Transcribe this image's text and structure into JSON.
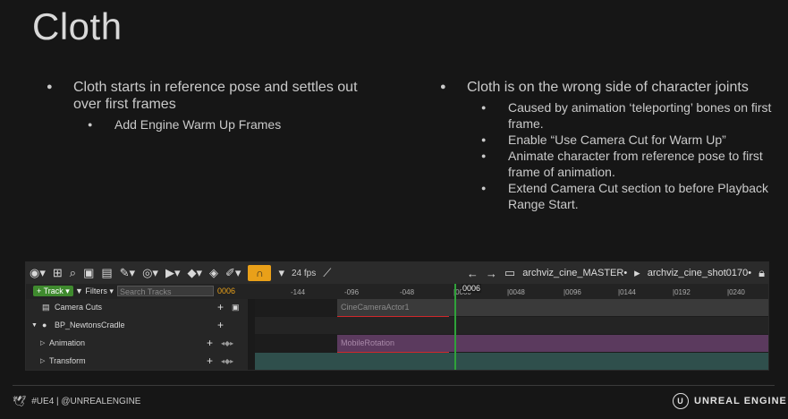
{
  "slide": {
    "title": "Cloth",
    "left_bullets": [
      {
        "text": "Cloth starts in reference pose and settles out over first frames",
        "sub": [
          "Add Engine Warm Up Frames"
        ]
      }
    ],
    "right_bullets": [
      {
        "text": "Cloth is on the wrong side of character joints",
        "sub": [
          "Caused by animation ‘teleporting’ bones on first frame.",
          "Enable “Use Camera Cut for Warm Up”",
          "Animate character from reference pose to first frame of animation.",
          "Extend Camera Cut section to before Playback Range Start."
        ]
      }
    ]
  },
  "sequencer": {
    "toolbar": {
      "fps": "24 fps",
      "breadcrumb_1": "archviz_cine_MASTER•",
      "breadcrumb_2": "archviz_cine_shot0170•"
    },
    "track_button": "Track",
    "filters_label": "Filters",
    "search_placeholder": "Search Tracks",
    "current_frame": "0006",
    "playhead_label": "0006",
    "ruler_ticks": [
      "-144",
      "-096",
      "-048",
      "|0000",
      "|0048",
      "|0096",
      "|0144",
      "|0192",
      "|0240"
    ],
    "tracks": [
      {
        "label": "Camera Cuts",
        "section": "CineCameraActor1"
      },
      {
        "label": "BP_NewtonsCradle",
        "section": ""
      },
      {
        "label": "Animation",
        "section": "MobileRotation"
      },
      {
        "label": "Transform",
        "section": ""
      }
    ]
  },
  "footer": {
    "social": "#UE4 | @UNREALENGINE",
    "brand": "UNREAL ENGINE"
  },
  "colors": {
    "background": "#161616",
    "accent_orange": "#e9a019",
    "track_green": "#3f8a2e",
    "playhead_green": "#2fa23a",
    "warmup_red": "#d0272b"
  }
}
